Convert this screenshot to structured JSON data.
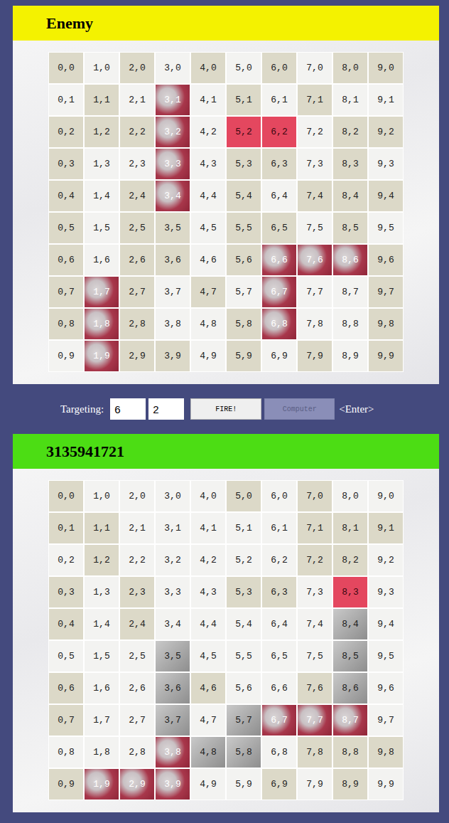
{
  "enemy_board": {
    "title": "Enemy",
    "rows": [
      [
        {
          "label": "0,0",
          "state": "miss"
        },
        {
          "label": "1,0",
          "state": "empty"
        },
        {
          "label": "2,0",
          "state": "miss"
        },
        {
          "label": "3,0",
          "state": "empty"
        },
        {
          "label": "4,0",
          "state": "miss"
        },
        {
          "label": "5,0",
          "state": "empty"
        },
        {
          "label": "6,0",
          "state": "miss"
        },
        {
          "label": "7,0",
          "state": "empty"
        },
        {
          "label": "8,0",
          "state": "miss"
        },
        {
          "label": "9,0",
          "state": "miss"
        }
      ],
      [
        {
          "label": "0,1",
          "state": "empty"
        },
        {
          "label": "1,1",
          "state": "miss"
        },
        {
          "label": "2,1",
          "state": "empty"
        },
        {
          "label": "3,1",
          "state": "sunk"
        },
        {
          "label": "4,1",
          "state": "empty"
        },
        {
          "label": "5,1",
          "state": "miss"
        },
        {
          "label": "6,1",
          "state": "empty"
        },
        {
          "label": "7,1",
          "state": "miss"
        },
        {
          "label": "8,1",
          "state": "empty"
        },
        {
          "label": "9,1",
          "state": "empty"
        }
      ],
      [
        {
          "label": "0,2",
          "state": "miss"
        },
        {
          "label": "1,2",
          "state": "miss"
        },
        {
          "label": "2,2",
          "state": "miss"
        },
        {
          "label": "3,2",
          "state": "sunk"
        },
        {
          "label": "4,2",
          "state": "empty"
        },
        {
          "label": "5,2",
          "state": "hit"
        },
        {
          "label": "6,2",
          "state": "hit"
        },
        {
          "label": "7,2",
          "state": "empty"
        },
        {
          "label": "8,2",
          "state": "miss"
        },
        {
          "label": "9,2",
          "state": "miss"
        }
      ],
      [
        {
          "label": "0,3",
          "state": "miss"
        },
        {
          "label": "1,3",
          "state": "empty"
        },
        {
          "label": "2,3",
          "state": "empty"
        },
        {
          "label": "3,3",
          "state": "sunk"
        },
        {
          "label": "4,3",
          "state": "empty"
        },
        {
          "label": "5,3",
          "state": "miss"
        },
        {
          "label": "6,3",
          "state": "miss"
        },
        {
          "label": "7,3",
          "state": "empty"
        },
        {
          "label": "8,3",
          "state": "miss"
        },
        {
          "label": "9,3",
          "state": "empty"
        }
      ],
      [
        {
          "label": "0,4",
          "state": "miss"
        },
        {
          "label": "1,4",
          "state": "empty"
        },
        {
          "label": "2,4",
          "state": "miss"
        },
        {
          "label": "3,4",
          "state": "sunk"
        },
        {
          "label": "4,4",
          "state": "empty"
        },
        {
          "label": "5,4",
          "state": "miss"
        },
        {
          "label": "6,4",
          "state": "empty"
        },
        {
          "label": "7,4",
          "state": "miss"
        },
        {
          "label": "8,4",
          "state": "miss"
        },
        {
          "label": "9,4",
          "state": "miss"
        }
      ],
      [
        {
          "label": "0,5",
          "state": "miss"
        },
        {
          "label": "1,5",
          "state": "empty"
        },
        {
          "label": "2,5",
          "state": "miss"
        },
        {
          "label": "3,5",
          "state": "miss"
        },
        {
          "label": "4,5",
          "state": "empty"
        },
        {
          "label": "5,5",
          "state": "miss"
        },
        {
          "label": "6,5",
          "state": "miss"
        },
        {
          "label": "7,5",
          "state": "empty"
        },
        {
          "label": "8,5",
          "state": "miss"
        },
        {
          "label": "9,5",
          "state": "empty"
        }
      ],
      [
        {
          "label": "0,6",
          "state": "miss"
        },
        {
          "label": "1,6",
          "state": "empty"
        },
        {
          "label": "2,6",
          "state": "miss"
        },
        {
          "label": "3,6",
          "state": "miss"
        },
        {
          "label": "4,6",
          "state": "empty"
        },
        {
          "label": "5,6",
          "state": "miss"
        },
        {
          "label": "6,6",
          "state": "sunk"
        },
        {
          "label": "7,6",
          "state": "sunk"
        },
        {
          "label": "8,6",
          "state": "sunk"
        },
        {
          "label": "9,6",
          "state": "miss"
        }
      ],
      [
        {
          "label": "0,7",
          "state": "miss"
        },
        {
          "label": "1,7",
          "state": "sunk"
        },
        {
          "label": "2,7",
          "state": "miss"
        },
        {
          "label": "3,7",
          "state": "empty"
        },
        {
          "label": "4,7",
          "state": "miss"
        },
        {
          "label": "5,7",
          "state": "empty"
        },
        {
          "label": "6,7",
          "state": "sunk"
        },
        {
          "label": "7,7",
          "state": "empty"
        },
        {
          "label": "8,7",
          "state": "empty"
        },
        {
          "label": "9,7",
          "state": "miss"
        }
      ],
      [
        {
          "label": "0,8",
          "state": "miss"
        },
        {
          "label": "1,8",
          "state": "sunk"
        },
        {
          "label": "2,8",
          "state": "miss"
        },
        {
          "label": "3,8",
          "state": "empty"
        },
        {
          "label": "4,8",
          "state": "empty"
        },
        {
          "label": "5,8",
          "state": "miss"
        },
        {
          "label": "6,8",
          "state": "sunk"
        },
        {
          "label": "7,8",
          "state": "empty"
        },
        {
          "label": "8,8",
          "state": "empty"
        },
        {
          "label": "9,8",
          "state": "miss"
        }
      ],
      [
        {
          "label": "0,9",
          "state": "empty"
        },
        {
          "label": "1,9",
          "state": "sunk"
        },
        {
          "label": "2,9",
          "state": "miss"
        },
        {
          "label": "3,9",
          "state": "miss"
        },
        {
          "label": "4,9",
          "state": "empty"
        },
        {
          "label": "5,9",
          "state": "miss"
        },
        {
          "label": "6,9",
          "state": "empty"
        },
        {
          "label": "7,9",
          "state": "miss"
        },
        {
          "label": "8,9",
          "state": "empty"
        },
        {
          "label": "9,9",
          "state": "miss"
        }
      ]
    ]
  },
  "controls": {
    "label": "Targeting:",
    "x": "6",
    "y": "2",
    "fire_button": {
      "label": "FIRE!",
      "disabled": false
    },
    "computer_button": {
      "label": "Computer",
      "disabled": true
    },
    "hint": "<Enter>"
  },
  "player_board": {
    "title": "3135941721",
    "rows": [
      [
        {
          "label": "0,0",
          "state": "miss"
        },
        {
          "label": "1,0",
          "state": "empty"
        },
        {
          "label": "2,0",
          "state": "empty"
        },
        {
          "label": "3,0",
          "state": "empty"
        },
        {
          "label": "4,0",
          "state": "empty"
        },
        {
          "label": "5,0",
          "state": "miss"
        },
        {
          "label": "6,0",
          "state": "empty"
        },
        {
          "label": "7,0",
          "state": "miss"
        },
        {
          "label": "8,0",
          "state": "empty"
        },
        {
          "label": "9,0",
          "state": "empty"
        }
      ],
      [
        {
          "label": "0,1",
          "state": "miss"
        },
        {
          "label": "1,1",
          "state": "miss"
        },
        {
          "label": "2,1",
          "state": "empty"
        },
        {
          "label": "3,1",
          "state": "empty"
        },
        {
          "label": "4,1",
          "state": "empty"
        },
        {
          "label": "5,1",
          "state": "empty"
        },
        {
          "label": "6,1",
          "state": "empty"
        },
        {
          "label": "7,1",
          "state": "miss"
        },
        {
          "label": "8,1",
          "state": "miss"
        },
        {
          "label": "9,1",
          "state": "miss"
        }
      ],
      [
        {
          "label": "0,2",
          "state": "empty"
        },
        {
          "label": "1,2",
          "state": "miss"
        },
        {
          "label": "2,2",
          "state": "empty"
        },
        {
          "label": "3,2",
          "state": "empty"
        },
        {
          "label": "4,2",
          "state": "empty"
        },
        {
          "label": "5,2",
          "state": "empty"
        },
        {
          "label": "6,2",
          "state": "empty"
        },
        {
          "label": "7,2",
          "state": "miss"
        },
        {
          "label": "8,2",
          "state": "miss"
        },
        {
          "label": "9,2",
          "state": "empty"
        }
      ],
      [
        {
          "label": "0,3",
          "state": "miss"
        },
        {
          "label": "1,3",
          "state": "empty"
        },
        {
          "label": "2,3",
          "state": "miss"
        },
        {
          "label": "3,3",
          "state": "empty"
        },
        {
          "label": "4,3",
          "state": "empty"
        },
        {
          "label": "5,3",
          "state": "miss"
        },
        {
          "label": "6,3",
          "state": "miss"
        },
        {
          "label": "7,3",
          "state": "empty"
        },
        {
          "label": "8,3",
          "state": "hit"
        },
        {
          "label": "9,3",
          "state": "empty"
        }
      ],
      [
        {
          "label": "0,4",
          "state": "miss"
        },
        {
          "label": "1,4",
          "state": "empty"
        },
        {
          "label": "2,4",
          "state": "miss"
        },
        {
          "label": "3,4",
          "state": "empty"
        },
        {
          "label": "4,4",
          "state": "empty"
        },
        {
          "label": "5,4",
          "state": "empty"
        },
        {
          "label": "6,4",
          "state": "empty"
        },
        {
          "label": "7,4",
          "state": "empty"
        },
        {
          "label": "8,4",
          "state": "ship"
        },
        {
          "label": "9,4",
          "state": "empty"
        }
      ],
      [
        {
          "label": "0,5",
          "state": "empty"
        },
        {
          "label": "1,5",
          "state": "empty"
        },
        {
          "label": "2,5",
          "state": "empty"
        },
        {
          "label": "3,5",
          "state": "ship"
        },
        {
          "label": "4,5",
          "state": "empty"
        },
        {
          "label": "5,5",
          "state": "empty"
        },
        {
          "label": "6,5",
          "state": "empty"
        },
        {
          "label": "7,5",
          "state": "empty"
        },
        {
          "label": "8,5",
          "state": "ship"
        },
        {
          "label": "9,5",
          "state": "empty"
        }
      ],
      [
        {
          "label": "0,6",
          "state": "miss"
        },
        {
          "label": "1,6",
          "state": "empty"
        },
        {
          "label": "2,6",
          "state": "empty"
        },
        {
          "label": "3,6",
          "state": "ship"
        },
        {
          "label": "4,6",
          "state": "miss"
        },
        {
          "label": "5,6",
          "state": "empty"
        },
        {
          "label": "6,6",
          "state": "empty"
        },
        {
          "label": "7,6",
          "state": "miss"
        },
        {
          "label": "8,6",
          "state": "ship"
        },
        {
          "label": "9,6",
          "state": "empty"
        }
      ],
      [
        {
          "label": "0,7",
          "state": "miss"
        },
        {
          "label": "1,7",
          "state": "empty"
        },
        {
          "label": "2,7",
          "state": "empty"
        },
        {
          "label": "3,7",
          "state": "ship"
        },
        {
          "label": "4,7",
          "state": "empty"
        },
        {
          "label": "5,7",
          "state": "ship"
        },
        {
          "label": "6,7",
          "state": "sunk"
        },
        {
          "label": "7,7",
          "state": "sunk"
        },
        {
          "label": "8,7",
          "state": "sunk"
        },
        {
          "label": "9,7",
          "state": "empty"
        }
      ],
      [
        {
          "label": "0,8",
          "state": "empty"
        },
        {
          "label": "1,8",
          "state": "empty"
        },
        {
          "label": "2,8",
          "state": "empty"
        },
        {
          "label": "3,8",
          "state": "sunk"
        },
        {
          "label": "4,8",
          "state": "ship"
        },
        {
          "label": "5,8",
          "state": "ship"
        },
        {
          "label": "6,8",
          "state": "empty"
        },
        {
          "label": "7,8",
          "state": "miss"
        },
        {
          "label": "8,8",
          "state": "miss"
        },
        {
          "label": "9,8",
          "state": "miss"
        }
      ],
      [
        {
          "label": "0,9",
          "state": "miss"
        },
        {
          "label": "1,9",
          "state": "sunk"
        },
        {
          "label": "2,9",
          "state": "sunk"
        },
        {
          "label": "3,9",
          "state": "sunk"
        },
        {
          "label": "4,9",
          "state": "empty"
        },
        {
          "label": "5,9",
          "state": "empty"
        },
        {
          "label": "6,9",
          "state": "miss"
        },
        {
          "label": "7,9",
          "state": "empty"
        },
        {
          "label": "8,9",
          "state": "miss"
        },
        {
          "label": "9,9",
          "state": "empty"
        }
      ]
    ]
  }
}
